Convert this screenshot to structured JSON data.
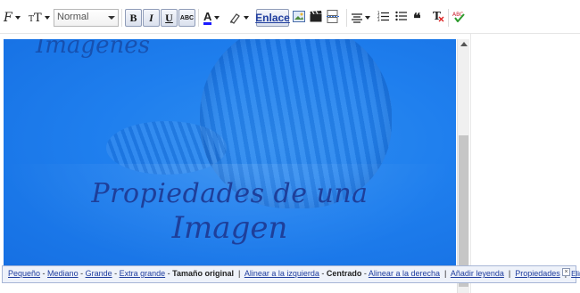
{
  "toolbar": {
    "font_label": "F",
    "size_label": "T",
    "paragraph_format": "Normal",
    "bold_label": "B",
    "italic_label": "I",
    "underline_label": "U",
    "strike_label": "ABC",
    "text_color_label": "A",
    "link_label": "Enlace",
    "text_color": "#1a1aff"
  },
  "image": {
    "watermark_text": "Imágenes",
    "title_line1": "Propiedades de una",
    "title_line2": "Imagen"
  },
  "image_popup": {
    "size_small": "Pequeño",
    "size_medium": "Mediano",
    "size_large": "Grande",
    "size_xlarge": "Extra grande",
    "size_original": "Tamaño original",
    "align_left": "Alinear a la izquierda",
    "align_center": "Centrado",
    "align_right": "Alinear a la derecha",
    "add_caption": "Añadir leyenda",
    "properties": "Propiedades",
    "delete": "Eliminar",
    "close_glyph": "×"
  },
  "colors": {
    "image_blue": "#1f7fee",
    "link_blue": "#1f3d9e"
  }
}
